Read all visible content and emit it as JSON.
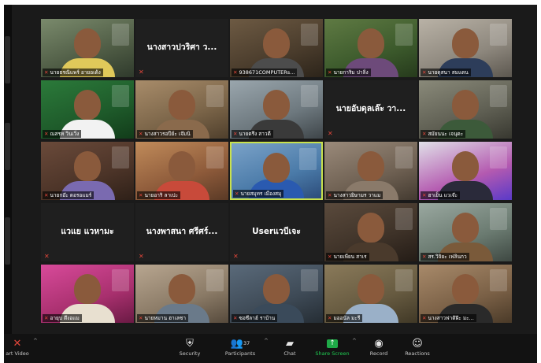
{
  "tiles": [
    {
      "name": "นายธรณิแพร์ อายอเด้ง",
      "type": "video",
      "c": [
        "#7a8a6c",
        "#4e5b44",
        "#2f3a2c"
      ],
      "shirt": "#e0c95a"
    },
    {
      "name": "นางสาวปวริศา ว...",
      "type": "name"
    },
    {
      "name": "938671COMPUTERs...",
      "type": "video",
      "c": [
        "#6d5a43",
        "#4a3c2c",
        "#2c241a"
      ],
      "shirt": "#4c4c4c"
    },
    {
      "name": "นายการิม ปาลิ่ง",
      "type": "video",
      "c": [
        "#5f7a43",
        "#3c5a2c",
        "#263a1c"
      ],
      "shirt": "#6d4a7a"
    },
    {
      "name": "นายดุสนา สมแดน",
      "type": "video",
      "c": [
        "#b9b2a6",
        "#8d877d",
        "#5c574f"
      ],
      "shirt": "#2d3d5a"
    },
    {
      "name": "ณสรห วินเวิ่ง",
      "type": "video",
      "c": [
        "#2b7a3a",
        "#1e5a2a",
        "#123c1a"
      ],
      "shirt": "#f2f2f2"
    },
    {
      "name": "นางสาวรอปีย์ะ เจ๊มนิ",
      "type": "video",
      "c": [
        "#a88c6a",
        "#7a6448",
        "#4f3f2c"
      ],
      "shirt": "#8a6a4c"
    },
    {
      "name": "นายตรึง สาวดี",
      "type": "video",
      "c": [
        "#9aa6ad",
        "#6d787e",
        "#3e4549"
      ],
      "shirt": "#3a3a3a"
    },
    {
      "name": "นายอับดุลเล๊ะ วา...",
      "type": "name"
    },
    {
      "name": "สมัยนนะ เจนุดะ",
      "type": "video",
      "c": [
        "#8a8a7a",
        "#5e5e52",
        "#383830"
      ],
      "shirt": "#3c5a3a"
    },
    {
      "name": "นายกอ๊ะ ดอรอแมร์",
      "type": "video",
      "c": [
        "#6a4a3a",
        "#4c3428",
        "#2e2018"
      ],
      "shirt": "#7a6ab0"
    },
    {
      "name": "นายอาริ ลาเปะ",
      "type": "video",
      "c": [
        "#c08b5a",
        "#8d5a3a",
        "#5a3a26"
      ],
      "shirt": "#c84a3a"
    },
    {
      "name": "นายสมุทร เมืองสมุ",
      "type": "video",
      "active": true,
      "c": [
        "#7aa2c8",
        "#4a7aa8",
        "#2c4c7a"
      ],
      "shirt": "#2a5ab0"
    },
    {
      "name": "นางสาวยิษามร วาแม",
      "type": "video",
      "c": [
        "#9a8a7a",
        "#6e6052",
        "#433a30"
      ],
      "shirt": "#8a7a6a"
    },
    {
      "name": "ฮาเย็น แวเจ๊ะ",
      "type": "video",
      "c": [
        "#e0e0e8",
        "#b45ab0",
        "#5a3ac8"
      ],
      "shirt": "#2a2a3a"
    },
    {
      "name": "แวแย แวหามะ",
      "type": "name"
    },
    {
      "name": "นางพาสนา ศรีศร์...",
      "type": "name"
    },
    {
      "name": "Userแวบีเจะ",
      "type": "name"
    },
    {
      "name": "นายเพียน สาเร",
      "type": "video",
      "c": [
        "#5a4a3c",
        "#3e3228",
        "#241c16"
      ],
      "shirt": "#4a3a2c"
    },
    {
      "name": "สร.วิจิยะ เฟลินกว",
      "type": "video",
      "c": [
        "#9aa8a0",
        "#6a7a70",
        "#3e4842"
      ],
      "shirt": "#7a5a3a"
    },
    {
      "name": "อายุบ ตึงอแม",
      "type": "video",
      "c": [
        "#d84a9a",
        "#a8306e",
        "#6a1a44"
      ],
      "shirt": "#e8e0d0"
    },
    {
      "name": "นายหมาน ฮาเลซา",
      "type": "video",
      "c": [
        "#b8a690",
        "#8a7a66",
        "#564a3c"
      ],
      "shirt": "#6a7a8a"
    },
    {
      "name": "ซอซีลาฮ์ ราบ้าน",
      "type": "video",
      "c": [
        "#5a6a7a",
        "#3e4a56",
        "#252d34"
      ],
      "shirt": "#3a4a5a"
    },
    {
      "name": "มออนัล มะรี",
      "type": "video",
      "c": [
        "#8a7a5a",
        "#665a40",
        "#403826"
      ],
      "shirt": "#9ab0c8"
    },
    {
      "name": "นางสาวฟาติฝ๊ะ มะ...",
      "type": "video",
      "c": [
        "#a88a6a",
        "#7a6046",
        "#4a3a28"
      ],
      "shirt": "#2a2a2a"
    }
  ],
  "toolbar": {
    "video_label": "art Video",
    "security_label": "Security",
    "participants_label": "Participants",
    "participants_count": "37",
    "chat_label": "Chat",
    "share_label": "Share Screen",
    "record_label": "Record",
    "reactions_label": "Reactions"
  },
  "colors": {
    "accent_active": "#c9e14d",
    "share_green": "#1fce52",
    "mic_red": "#e0463a"
  }
}
